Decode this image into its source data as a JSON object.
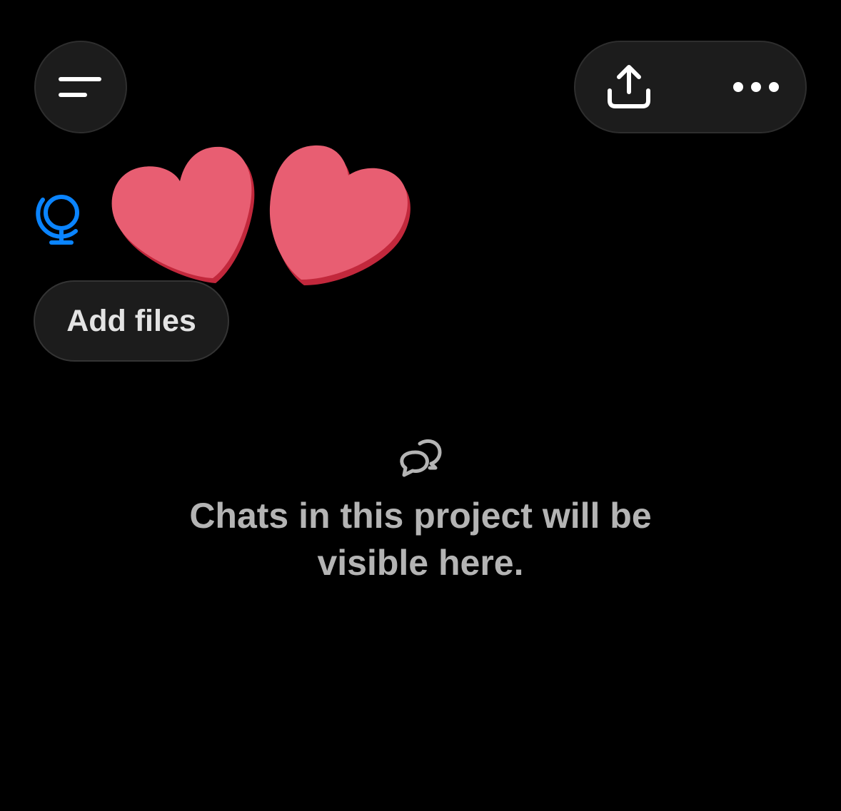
{
  "header": {
    "menu_icon": "menu-lines-icon",
    "share_icon": "share-upload-icon",
    "more_icon": "more-horizontal-icon"
  },
  "project": {
    "icon": "globe-icon",
    "icon_color": "#0a84ff",
    "title": "",
    "overlay_icon": "hearts-sticker-icon",
    "overlay_color": "#e85e72"
  },
  "actions": {
    "add_files_label": "Add files"
  },
  "empty_state": {
    "icon": "chats-icon",
    "message": "Chats in this project will be visible here."
  },
  "colors": {
    "background": "#000000",
    "pill_background": "#1c1c1c",
    "muted_text": "#b4b4b4"
  }
}
